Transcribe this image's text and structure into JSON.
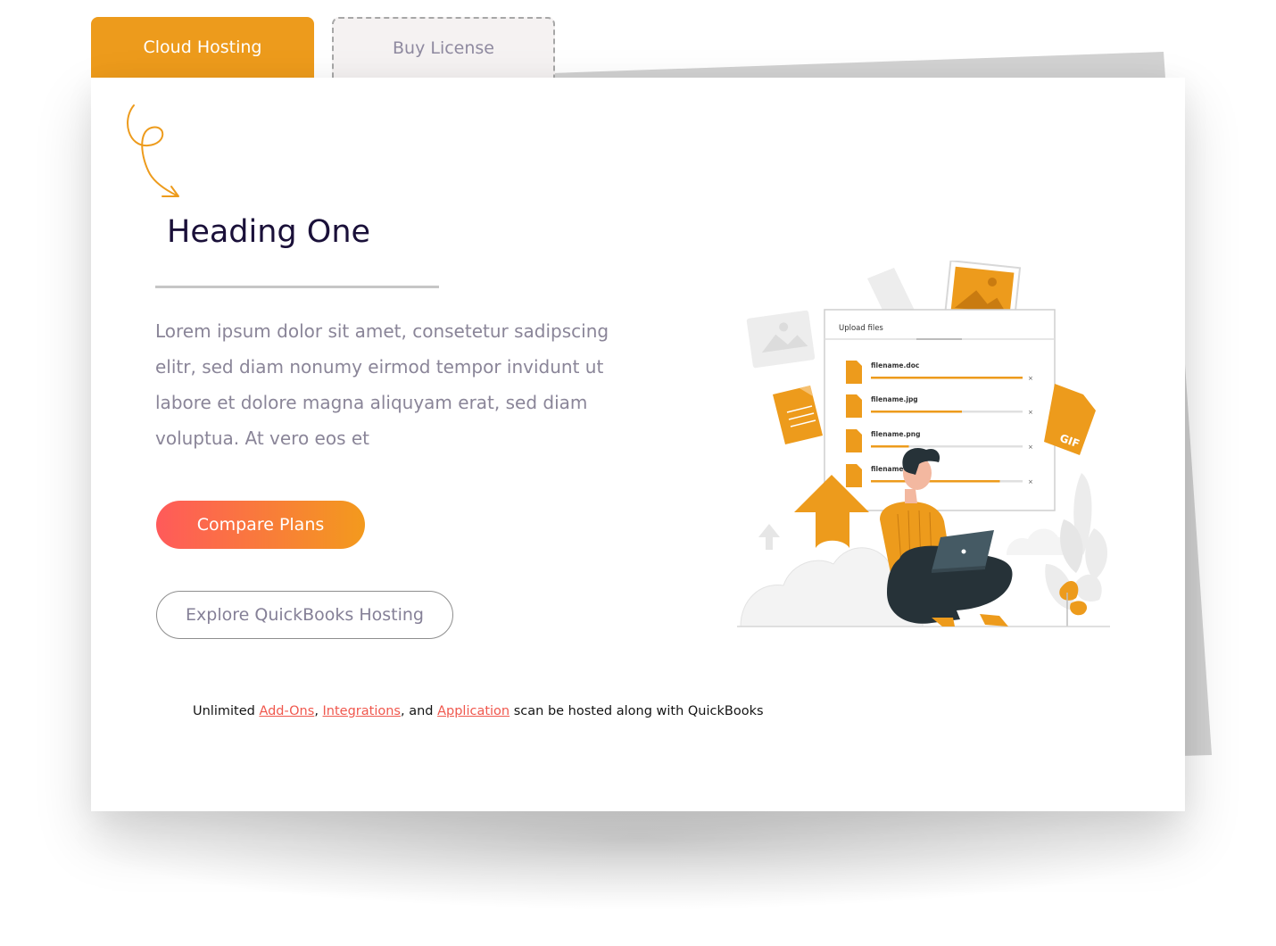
{
  "tabs": [
    {
      "label": "Cloud Hosting",
      "active": true
    },
    {
      "label": "Buy License",
      "active": false
    }
  ],
  "hero": {
    "heading": "Heading One",
    "paragraph": "Lorem ipsum dolor sit amet, consetetur sadipscing elitr, sed diam nonumy eirmod tempor invidunt ut labore et dolore magna aliquyam erat, sed diam voluptua. At vero eos et",
    "primary_button": "Compare Plans",
    "secondary_button": "Explore QuickBooks Hosting"
  },
  "footnote": {
    "prefix": "Unlimited ",
    "link1": "Add-Ons",
    "sep1": ", ",
    "link2": "Integrations",
    "sep2": ", and ",
    "link3": "Application",
    "suffix": "scan be hosted along with QuickBooks"
  },
  "illustration": {
    "window_title": "Upload files",
    "files": [
      {
        "name": "filename.doc",
        "progress": 1.0
      },
      {
        "name": "filename.jpg",
        "progress": 0.6
      },
      {
        "name": "filename.png",
        "progress": 0.25
      },
      {
        "name": "filename.",
        "progress": 0.85
      }
    ],
    "badge": "GIF"
  },
  "colors": {
    "accent": "#ed9b1c",
    "heading": "#1a1039",
    "body_text": "#8a8598",
    "link": "#f0584e",
    "gradient_start": "#ff5a5a",
    "gradient_end": "#f39a1d"
  }
}
